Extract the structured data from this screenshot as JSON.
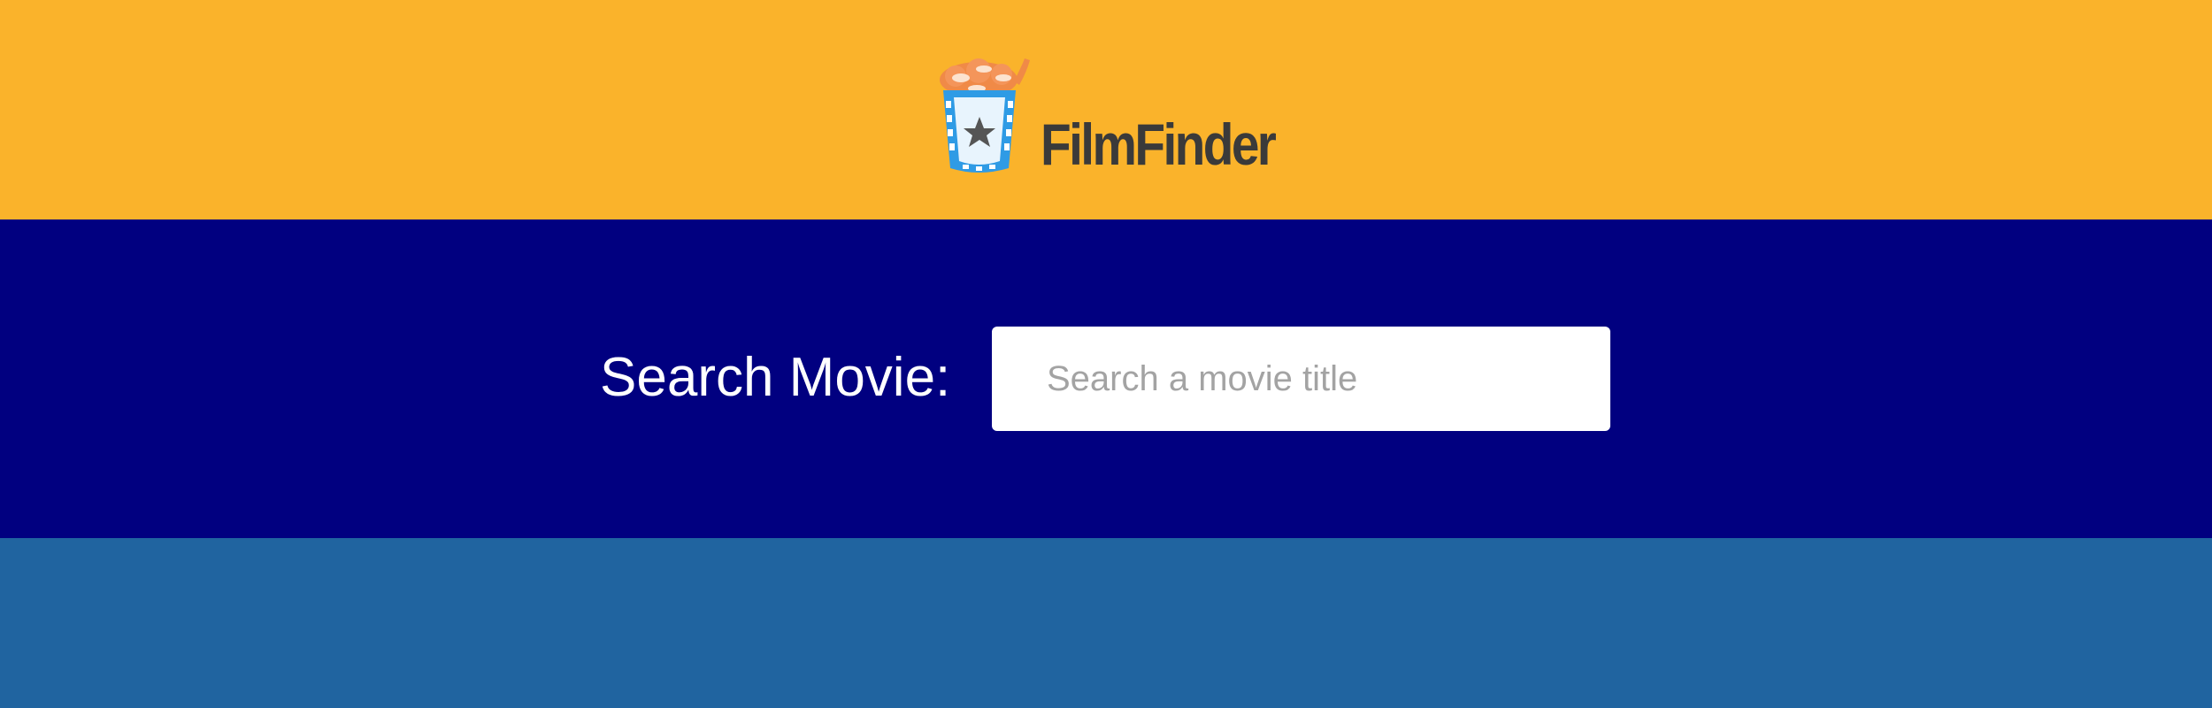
{
  "header": {
    "app_name": "FilmFinder",
    "logo_icon": "popcorn-film-cup-icon",
    "background_color": "#FAB32B"
  },
  "search": {
    "label": "Search Movie:",
    "input_value": "",
    "placeholder": "Search a movie title",
    "background_color": "#010080"
  },
  "results": {
    "background_color": "#2064A0"
  }
}
